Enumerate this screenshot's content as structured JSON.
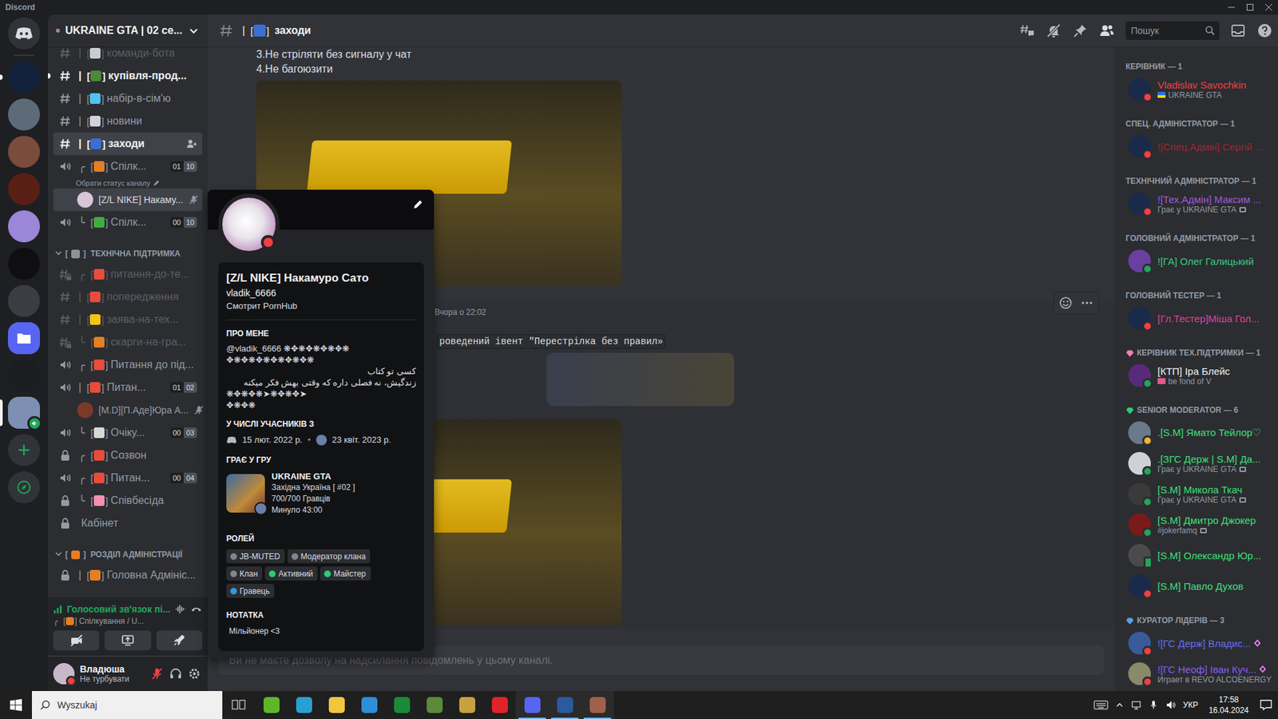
{
  "window": {
    "title": "Discord"
  },
  "servers": [
    {
      "kind": "server",
      "color": "#14213d",
      "selected": false,
      "unread": true,
      "in_voice": false
    },
    {
      "kind": "server",
      "color": "#5d6b78",
      "selected": false,
      "unread": false,
      "in_voice": false
    },
    {
      "kind": "server",
      "color": "#7a4c3c",
      "selected": false,
      "unread": false,
      "in_voice": false
    },
    {
      "kind": "server",
      "color": "#5a1f14",
      "selected": false,
      "unread": false,
      "in_voice": false
    },
    {
      "kind": "server",
      "color": "#9b86d9",
      "selected": false,
      "unread": false,
      "in_voice": false
    },
    {
      "kind": "server",
      "color": "#0f0f12",
      "selected": false,
      "unread": false,
      "in_voice": false
    },
    {
      "kind": "server",
      "color": "#3a3d44",
      "selected": false,
      "unread": false,
      "in_voice": false
    },
    {
      "kind": "folder",
      "color": "#5865f2",
      "selected": false,
      "unread": false,
      "in_voice": false
    },
    {
      "kind": "server",
      "color": "#1b1d20",
      "selected": false,
      "unread": false,
      "in_voice": false
    },
    {
      "kind": "server",
      "color": "#7d8fb3",
      "selected": true,
      "unread": false,
      "in_voice": true
    }
  ],
  "server_header": {
    "name": "UKRAINE GTA | 02 се..."
  },
  "brackets": {
    "open": "[",
    "close": "]"
  },
  "channels": [
    {
      "kind": "text",
      "prefix": "|",
      "emoji_color": "#c9ccd1",
      "name": "команди-бота",
      "muted": true,
      "unread": false,
      "selected": false
    },
    {
      "kind": "text",
      "prefix": "|",
      "emoji_color": "#4a8a3a",
      "name": "купівля-прод...",
      "muted": false,
      "unread": true,
      "selected": false
    },
    {
      "kind": "text",
      "prefix": "|",
      "emoji_color": "#4fc3f7",
      "name": "набір-в-сім'ю",
      "muted": false,
      "unread": false,
      "selected": false
    },
    {
      "kind": "text",
      "prefix": "|",
      "emoji_color": "#d0d4da",
      "name": "новини",
      "muted": false,
      "unread": false,
      "selected": false
    },
    {
      "kind": "text",
      "prefix": "|",
      "emoji_color": "#3b6fd4",
      "name": "заходи",
      "muted": false,
      "unread": false,
      "selected": true
    },
    {
      "kind": "voice",
      "prefix": "╭",
      "emoji_color": "#e67e22",
      "name": "Спілк...",
      "users": "01",
      "limit": "10",
      "muted": false,
      "unread": false,
      "selected": false
    },
    {
      "kind": "status",
      "text": "Обрати статус каналу"
    },
    {
      "kind": "member",
      "name": "[Z/L NIKE] Накаму...",
      "avatar_color": "#d8c6d8",
      "selected": true,
      "server_muted": true
    },
    {
      "kind": "voice",
      "prefix": "╰",
      "emoji_color": "#3fae3f",
      "name": "Спілк...",
      "users": "00",
      "limit": "10",
      "muted": false,
      "unread": false,
      "selected": false
    },
    {
      "kind": "category",
      "emoji_color": "#8e9297",
      "name": "ТЕХНІЧНА ПІДТРИМКА",
      "expanded": true
    },
    {
      "kind": "text_locked",
      "prefix": "╭",
      "emoji_color": "#e74c3c",
      "name": "питання-до-те...",
      "muted": true,
      "unread": false,
      "selected": false
    },
    {
      "kind": "text",
      "prefix": "|",
      "emoji_color": "#e74c3c",
      "name": "попередження",
      "muted": true,
      "unread": false,
      "selected": false
    },
    {
      "kind": "text",
      "prefix": "|",
      "emoji_color": "#f1c40f",
      "name": "заява-на-тех...",
      "muted": true,
      "unread": false,
      "selected": false
    },
    {
      "kind": "text_locked",
      "prefix": "╰",
      "emoji_color": "#e67e22",
      "name": "скарги-на-гра...",
      "muted": true,
      "unread": false,
      "selected": false
    },
    {
      "kind": "voice",
      "prefix": "╭",
      "emoji_color": "#e74c3c",
      "name": "Питання до під...",
      "muted": false,
      "unread": false,
      "selected": false
    },
    {
      "kind": "voice",
      "prefix": "|",
      "emoji_color": "#e74c3c",
      "name": "Питан...",
      "users": "01",
      "limit": "02",
      "muted": false,
      "unread": false,
      "selected": false
    },
    {
      "kind": "member",
      "name": "[M.D][П.Аде]Юра А...",
      "avatar_color": "#7a3a2a",
      "selected": false,
      "server_muted": true
    },
    {
      "kind": "voice",
      "prefix": "╰",
      "emoji_color": "#d8d8d8",
      "name": "Очіку...",
      "users": "00",
      "limit": "03",
      "muted": false,
      "unread": false,
      "selected": false
    },
    {
      "kind": "locked",
      "prefix": "╭",
      "emoji_color": "#e74c3c",
      "name": "Созвон",
      "muted": false,
      "unread": false,
      "selected": false
    },
    {
      "kind": "voice",
      "prefix": "╭",
      "emoji_color": "#e74c3c",
      "name": "Питан...",
      "users": "00",
      "limit": "04",
      "muted": false,
      "unread": false,
      "selected": false
    },
    {
      "kind": "locked",
      "prefix": "╰",
      "emoji_color": "#f48fb1",
      "name": "Співбесіда",
      "muted": false,
      "unread": false,
      "selected": false
    },
    {
      "kind": "locked",
      "name": "Кабінет",
      "muted": false,
      "unread": false,
      "selected": false
    },
    {
      "kind": "category",
      "emoji_color": "#e67e22",
      "name": "РОЗДІЛ АДМІНІСТРАЦІЇ",
      "expanded": true
    },
    {
      "kind": "locked",
      "prefix": "|",
      "emoji_color": "#e67e22",
      "name": "Головна Адмініс...",
      "muted": false,
      "unread": false,
      "selected": false
    }
  ],
  "voice_panel": {
    "title": "Голосовий зв'язок пі...",
    "prefix": "╭",
    "emoji_color": "#e67e22",
    "channel": "Спілкування / U..."
  },
  "user_panel": {
    "name": "Владюша",
    "status": "Не турбувати",
    "presence": "dnd",
    "avatar_color": "#c9b8c9",
    "mic_muted": true
  },
  "chat_header": {
    "prefix": "|",
    "emoji_color": "#3b6fd4",
    "channel": "заходи",
    "search_placeholder": "Пошук"
  },
  "messages": [
    {
      "lines": [
        "3.Не стріляти без сигналу у чат",
        "4.Не багоюзити"
      ],
      "image": true,
      "hovered": false
    },
    {
      "time": "Вчора о 22:02",
      "code": "роведений івент \"Перестрілка без правил»",
      "logo": true,
      "image": true,
      "hovered": true
    }
  ],
  "input": {
    "notice": "Ви не маєте дозволу на надсилання повідомлень у цьому каналі."
  },
  "member_groups": [
    {
      "title": "КЕРІВНИК — 1",
      "members": [
        {
          "name": "Vladislav Savochkin",
          "color": "#f23f43",
          "status": "dnd",
          "avatar_color": "#1a2a4a",
          "activity": "UKRAINE GTA",
          "status_emoji_colors": [
            "#2f6fd6",
            "#f5d90a"
          ],
          "activity_icon": false,
          "boosting": false
        }
      ]
    },
    {
      "title": "СПЕЦ. АДМІНІСТРАТОР — 1",
      "members": [
        {
          "name": "![Спец.Адмін] Сергій ...",
          "color": "#a3262f",
          "status": "dnd",
          "avatar_color": "#1a2a4a",
          "activity_icon": false,
          "boosting": false
        }
      ]
    },
    {
      "title": "ТЕХНІЧНИЙ АДМІНІСТРАТОР — 1",
      "members": [
        {
          "name": "![Тех.Адмін] Максим ...",
          "color": "#a05bd8",
          "status": "dnd",
          "avatar_color": "#1a2a4a",
          "activity": "Грає у UKRAINE GTA",
          "activity_icon": true,
          "boosting": false
        }
      ]
    },
    {
      "title": "ГОЛОВНИЙ АДМІНІСТРАТОР — 1",
      "members": [
        {
          "name": "![ГА] Олег Галицький",
          "color": "#3ec97f",
          "status": "online",
          "avatar_color": "#6a3fa0",
          "activity_icon": false,
          "boosting": false
        }
      ]
    },
    {
      "title": "ГОЛОВНИЙ ТЕСТЕР — 1",
      "members": [
        {
          "name": "[Гл.Тестер]Міша Гол...",
          "color": "#e0409a",
          "status": "dnd",
          "avatar_color": "#1a2a4a",
          "activity_icon": false,
          "boosting": false
        }
      ]
    },
    {
      "title": "КЕРІВНИК ТЕХ.ПІДТРИМКИ — 1",
      "icon_color": "#f47fb0",
      "members": [
        {
          "name": "[КТП] Іра Блейс",
          "color": "#f2f3f5",
          "status": "online",
          "avatar_color": "#5a2a7a",
          "activity": "be fond of V",
          "status_emoji_colors": [
            "#e05a8a"
          ],
          "activity_icon": false,
          "boosting": false
        }
      ]
    },
    {
      "title": "SENIOR MODERATOR — 6",
      "icon_color": "#2ecc71",
      "members": [
        {
          "name": ".[S.M] Ямато Тейлор♡",
          "color": "#3ee07a",
          "status": "idle",
          "avatar_color": "#6a7a8a",
          "activity_icon": false,
          "boosting": false
        },
        {
          "name": ".[ЗГС Держ | S.M] Да...",
          "color": "#3ee07a",
          "status": "online",
          "avatar_color": "#d0d0d8",
          "activity": "Грає у UKRAINE GTA",
          "activity_icon": true,
          "boosting": false
        },
        {
          "name": "[S.M] Микола Ткач",
          "color": "#3ee07a",
          "status": "online",
          "avatar_color": "#3a3a3a",
          "activity": "Грає у UKRAINE GTA",
          "activity_icon": true,
          "boosting": false
        },
        {
          "name": "[S.M] Дмитро Джокер",
          "color": "#3ee07a",
          "status": "online",
          "avatar_color": "#7a1a1a",
          "activity": "#jokerfamq",
          "activity_icon": true,
          "boosting": false
        },
        {
          "name": "[S.M] Олександр Юр...",
          "color": "#3ee07a",
          "status": "mobile",
          "avatar_color": "#4a4a4a",
          "activity_icon": false,
          "boosting": false
        },
        {
          "name": "[S.M] Павло Духов",
          "color": "#3ee07a",
          "status": "dnd",
          "avatar_color": "#1a2a4a",
          "activity_icon": false,
          "boosting": false
        }
      ]
    },
    {
      "title": "КУРАТОР ЛІДЕРІВ — 3",
      "icon_color": "#5aa0e6",
      "members": [
        {
          "name": "![ГС Держ] Владис...",
          "color": "#6a6cf0",
          "status": "dnd",
          "avatar_color": "#3a5a9a",
          "activity_icon": false,
          "boosting": true
        },
        {
          "name": "![ГС Неоф] Іван Куч...",
          "color": "#8a5cf0",
          "status": "dnd",
          "avatar_color": "#8a8a6a",
          "activity": "Играет в REVO ALCOENERGY",
          "activity_icon": false,
          "boosting": true
        }
      ]
    }
  ],
  "profile": {
    "name": "[Z/L NIKE] Накамуро Сато",
    "username": "vladik_6666",
    "custom_status": "Смотрит PornHub",
    "status": "dnd",
    "about_title": "ПРО МЕНЕ",
    "about": [
      "@vladik_6666 ❋✥❋✥❋✥❋✥❋",
      "✥❋✥❋✥❋✥❋✥❋✥❋",
      "کسی تو کتاب",
      "زندگیش، نه فصلی داره که وقتی بهش فکر میکنه",
      "❋✥❋✥❋➤❋✥❋✥➤",
      "✥❋✥❋"
    ],
    "member_since_title": "У ЧИСЛІ УЧАСНИКІВ З",
    "discord_since": "15 лют. 2022 р.",
    "separator": "•",
    "server_since": "23 квіт. 2023 р.",
    "game_title": "ГРАЄ У ГРУ",
    "game": {
      "name": "UKRAINE GTA",
      "details": "Західна Україна [ #02 ]",
      "state": "700/700 Гравців",
      "elapsed": "Минуло 43:00"
    },
    "roles_title": "РОЛЕЙ",
    "roles": [
      {
        "name": "JB-MUTED",
        "color": "#80848e"
      },
      {
        "name": "Модератор клана",
        "color": "#80848e"
      },
      {
        "name": "Клан",
        "color": "#80848e"
      },
      {
        "name": "Активний",
        "color": "#2ecc71"
      },
      {
        "name": "Майстер",
        "color": "#2ecc71"
      },
      {
        "name": "Гравець",
        "color": "#3498db"
      }
    ],
    "note_title": "НОТАТКА",
    "note": "Мільйонер <3"
  },
  "taskbar": {
    "search_placeholder": "Wyszukaj",
    "apps": [
      {
        "color": "#5cb82a",
        "active": false
      },
      {
        "color": "#2a9fd6",
        "active": false
      },
      {
        "color": "#f4c542",
        "active": false
      },
      {
        "color": "#2d8fd6",
        "active": false
      },
      {
        "color": "#1a8a3a",
        "active": false
      },
      {
        "color": "#5a8a3a",
        "active": false
      },
      {
        "color": "#c7a040",
        "active": false
      },
      {
        "color": "#e0232b",
        "active": false
      },
      {
        "color": "#5865f2",
        "active": true
      },
      {
        "color": "#2a5aa0",
        "active": true
      },
      {
        "color": "#a0604a",
        "active": true
      }
    ],
    "language": "УКР",
    "time": "17:58",
    "date": "16.04.2024"
  }
}
